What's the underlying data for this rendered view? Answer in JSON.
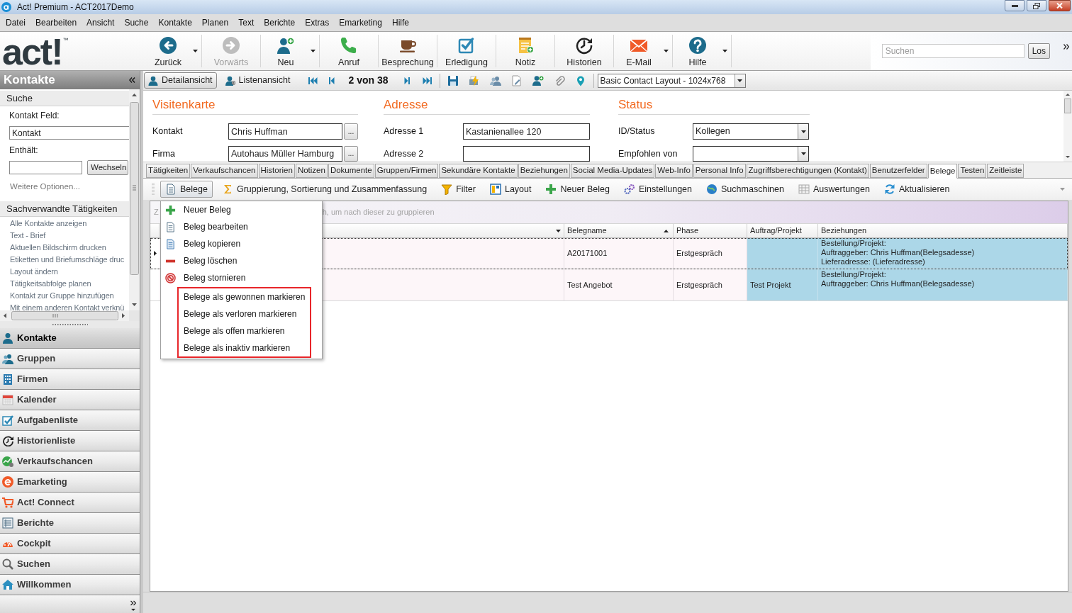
{
  "window": {
    "title": "Act! Premium - ACT2017Demo"
  },
  "menu_bar": [
    "Datei",
    "Bearbeiten",
    "Ansicht",
    "Suche",
    "Kontakte",
    "Planen",
    "Text",
    "Berichte",
    "Extras",
    "Emarketing",
    "Hilfe"
  ],
  "logo": {
    "text": "act!",
    "mark": "™"
  },
  "toolbar": [
    {
      "label": "Zurück",
      "disabled": false,
      "has_menu": true
    },
    {
      "label": "Vorwärts",
      "disabled": true,
      "has_menu": false
    },
    {
      "label": "Neu",
      "disabled": false,
      "has_menu": true
    },
    {
      "label": "Anruf",
      "disabled": false,
      "has_menu": false
    },
    {
      "label": "Besprechung",
      "disabled": false,
      "has_menu": false
    },
    {
      "label": "Erledigung",
      "disabled": false,
      "has_menu": false
    },
    {
      "label": "Notiz",
      "disabled": false,
      "has_menu": false
    },
    {
      "label": "Historien",
      "disabled": false,
      "has_menu": false
    },
    {
      "label": "E-Mail",
      "disabled": false,
      "has_menu": true
    },
    {
      "label": "Hilfe",
      "disabled": false,
      "has_menu": true
    }
  ],
  "search": {
    "placeholder": "Suchen",
    "button": "Los"
  },
  "sidebar": {
    "title": "Kontakte",
    "search_panel": {
      "title": "Suche",
      "field_label": "Kontakt Feld:",
      "field_value": "Kontakt",
      "contains_label": "Enthält:",
      "switch_button": "Wechseln",
      "more_options": "Weitere Optionen..."
    },
    "related_panel": {
      "title": "Sachverwandte Tätigkeiten",
      "links": [
        "Alle Kontakte anzeigen",
        "Text - Brief",
        "Aktuellen Bildschirm drucken",
        "Etiketten und Briefumschläge druc",
        "Layout ändern",
        "Tätigkeitsabfolge planen",
        "Kontakt zur Gruppe hinzufügen",
        "Mit einem anderen Kontakt verknü"
      ]
    },
    "nav": [
      {
        "label": "Kontakte",
        "selected": true
      },
      {
        "label": "Gruppen",
        "selected": false
      },
      {
        "label": "Firmen",
        "selected": false
      },
      {
        "label": "Kalender",
        "selected": false
      },
      {
        "label": "Aufgabenliste",
        "selected": false
      },
      {
        "label": "Historienliste",
        "selected": false
      },
      {
        "label": "Verkaufschancen",
        "selected": false
      },
      {
        "label": "Emarketing",
        "selected": false
      },
      {
        "label": "Act! Connect",
        "selected": false
      },
      {
        "label": "Berichte",
        "selected": false
      },
      {
        "label": "Cockpit",
        "selected": false
      },
      {
        "label": "Suchen",
        "selected": false
      },
      {
        "label": "Willkommen",
        "selected": false
      }
    ]
  },
  "view_bar": {
    "views": [
      {
        "label": "Detailansicht",
        "selected": true
      },
      {
        "label": "Listenansicht",
        "selected": false
      }
    ],
    "record_position": "2 von 38",
    "layout": "Basic Contact Layout - 1024x768"
  },
  "form": {
    "sections": [
      {
        "title": "Visitenkarte",
        "fields": [
          {
            "label": "Kontakt",
            "kind": "lookup",
            "value": "Chris Huffman",
            "button": "..."
          },
          {
            "label": "Firma",
            "kind": "lookup",
            "value": "Autohaus Müller Hamburg",
            "button": "..."
          }
        ]
      },
      {
        "title": "Adresse",
        "fields": [
          {
            "label": "Adresse 1",
            "kind": "text",
            "value": "Kastanienallee 120"
          },
          {
            "label": "Adresse 2",
            "kind": "text"
          }
        ]
      },
      {
        "title": "Status",
        "fields": [
          {
            "label": "ID/Status",
            "kind": "dropdown",
            "value": "Kollegen"
          },
          {
            "label": "Empfohlen von",
            "kind": "dropdown"
          }
        ]
      }
    ]
  },
  "tabs": [
    {
      "label": "Tätigkeiten",
      "selected": false
    },
    {
      "label": "Verkaufschancen",
      "selected": false
    },
    {
      "label": "Historien",
      "selected": false
    },
    {
      "label": "Notizen",
      "selected": false
    },
    {
      "label": "Dokumente",
      "selected": false
    },
    {
      "label": "Gruppen/Firmen",
      "selected": false
    },
    {
      "label": "Sekundäre Kontakte",
      "selected": false
    },
    {
      "label": "Beziehungen",
      "selected": false
    },
    {
      "label": "Social Media-Updates",
      "selected": false
    },
    {
      "label": "Web-Info",
      "selected": false
    },
    {
      "label": "Personal Info",
      "selected": false
    },
    {
      "label": "Zugriffsberechtigungen (Kontakt)",
      "selected": false
    },
    {
      "label": "Benutzerfelder",
      "selected": false
    },
    {
      "label": "Belege",
      "selected": true
    },
    {
      "label": "Testen",
      "selected": false
    },
    {
      "label": "Zeitleiste",
      "selected": false
    }
  ],
  "belege_toolbar": [
    {
      "label": "Belege",
      "expanded": true
    },
    {
      "label": "Gruppierung, Sortierung und Zusammenfassung",
      "expanded": false
    },
    {
      "label": "Filter",
      "expanded": false
    },
    {
      "label": "Layout",
      "expanded": false
    },
    {
      "label": "Neuer Beleg",
      "expanded": false
    },
    {
      "label": "Einstellungen",
      "expanded": false
    },
    {
      "label": "Suchmaschinen",
      "expanded": false
    },
    {
      "label": "Auswertungen",
      "expanded": false
    },
    {
      "label": "Aktualisieren",
      "expanded": false
    }
  ],
  "grid": {
    "group_hint": [
      "Z",
      "h, um nach dieser zu gruppieren"
    ],
    "columns": [
      {
        "label": "Belegname",
        "sorted": true
      },
      {
        "label": "Phase",
        "sorted": false
      },
      {
        "label": "Auftrag/Projekt",
        "sorted": false
      },
      {
        "label": "Beziehungen",
        "sorted": false
      }
    ],
    "rows": [
      {
        "selected": true,
        "belegname": "A20171001",
        "phase": "Erstgespräch",
        "beziehungen": "Bestellung/Projekt:\nAuftraggeber: Chris Huffman(Belegsadesse)\nLieferadresse: (Lieferadresse)"
      },
      {
        "selected": false,
        "belegname": "Test Angebot",
        "phase": "Erstgespräch",
        "auftrag_projekt": "Test Projekt",
        "beziehungen": "Bestellung/Projekt:\nAuftraggeber: Chris Huffman(Belegsadesse)"
      }
    ]
  },
  "context_menu": {
    "items": [
      {
        "label": "Neuer Beleg",
        "highlighted": false
      },
      {
        "label": "Beleg bearbeiten",
        "highlighted": false
      },
      {
        "label": "Beleg kopieren",
        "highlighted": false
      },
      {
        "label": "Beleg löschen",
        "highlighted": false
      },
      {
        "label": "Beleg stornieren",
        "highlighted": false
      },
      {
        "label": "Belege als gewonnen markieren",
        "highlighted": true
      },
      {
        "label": "Belege als verloren markieren",
        "highlighted": true
      },
      {
        "label": "Belege als offen markieren",
        "highlighted": true
      },
      {
        "label": "Belege als inaktiv markieren",
        "highlighted": true
      }
    ]
  }
}
